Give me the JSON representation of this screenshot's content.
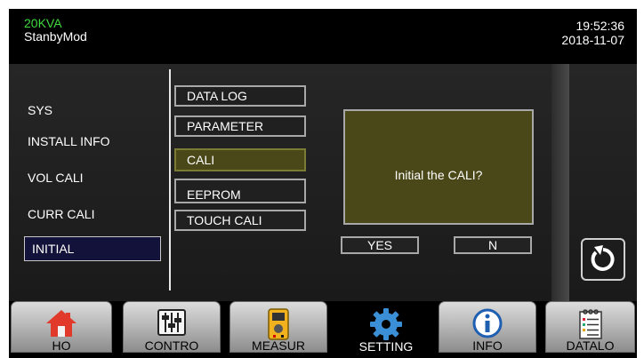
{
  "header": {
    "model": "20KVA",
    "mode": "StanbyMod",
    "time": "19:52:36",
    "date": "2018-11-07"
  },
  "left_menu": [
    {
      "label": "SYS",
      "active": false
    },
    {
      "label": "INSTALL INFO",
      "active": false
    },
    {
      "label": "VOL CALI",
      "active": false
    },
    {
      "label": "CURR CALI",
      "active": false
    },
    {
      "label": "INITIAL",
      "active": true
    }
  ],
  "sub_menu": [
    {
      "label": "DATA LOG",
      "active": false
    },
    {
      "label": "PARAMETER",
      "active": false
    },
    {
      "label": "CALI",
      "active": true
    },
    {
      "label": "EEPROM",
      "active": false
    },
    {
      "label": "TOUCH CALI",
      "active": false
    }
  ],
  "dialog": {
    "message": "Initial the CALI?",
    "yes_label": "YES",
    "no_label": "N"
  },
  "nav": [
    {
      "label": "HO",
      "icon": "home-icon",
      "active": false
    },
    {
      "label": "CONTRO",
      "icon": "sliders-icon",
      "active": false
    },
    {
      "label": "MEASUR",
      "icon": "multimeter-icon",
      "active": false
    },
    {
      "label": "SETTING",
      "icon": "gear-icon",
      "active": true
    },
    {
      "label": "INFO",
      "icon": "info-icon",
      "active": false
    },
    {
      "label": "DATALO",
      "icon": "notepad-icon",
      "active": false
    }
  ],
  "back_icon": "refresh-icon",
  "colors": {
    "model_text": "#3fd93f",
    "active_menu": "#12123a",
    "highlight": "#4a4718"
  }
}
